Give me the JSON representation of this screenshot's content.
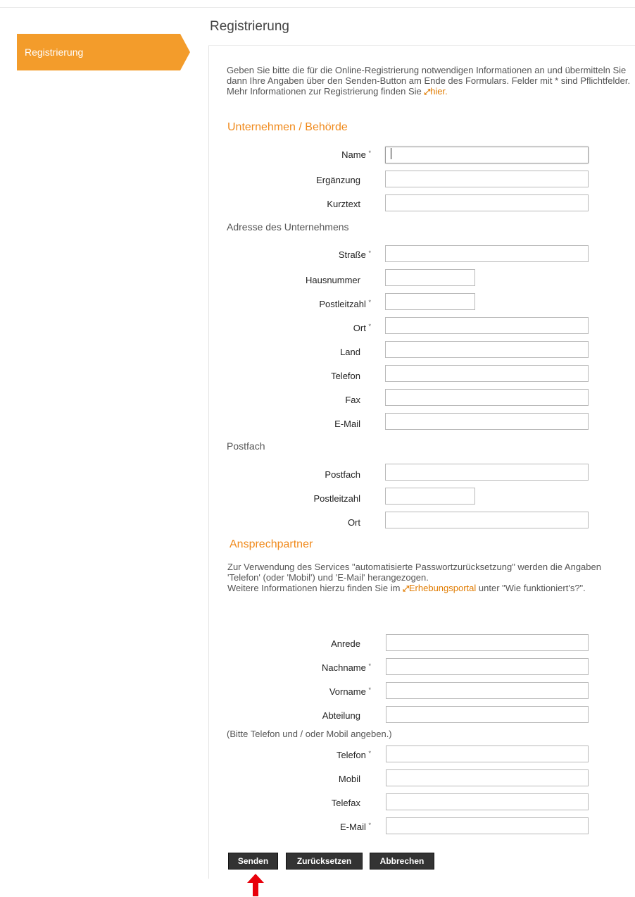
{
  "nav": {
    "item": "Registrierung"
  },
  "page_title": "Registrierung",
  "intro": {
    "text_before": "Geben Sie bitte die für die Online-Registrierung notwendigen Informationen an und übermitteln Sie dann Ihre Angaben über den Senden-Button am Ende des Formulars. Felder mit * sind Pflichtfelder. Mehr Informationen zur Registrierung finden Sie ",
    "link": "hier."
  },
  "company": {
    "title": "Unternehmen / Behörde",
    "name_label": "Name",
    "erg_label": "Ergänzung",
    "kurz_label": "Kurztext"
  },
  "address": {
    "title": "Adresse des Unternehmens",
    "strasse_label": "Straße",
    "hausnr_label": "Hausnummer",
    "plz_label": "Postleitzahl",
    "ort_label": "Ort",
    "land_label": "Land",
    "tel_label": "Telefon",
    "fax_label": "Fax",
    "email_label": "E-Mail"
  },
  "postfach": {
    "title": "Postfach",
    "postfach_label": "Postfach",
    "plz_label": "Postleitzahl",
    "ort_label": "Ort"
  },
  "contact": {
    "title": "Ansprechpartner",
    "info_1": "Zur Verwendung des Services \"automatisierte Passwortzurücksetzung\" werden die Angaben 'Telefon' (oder 'Mobil') und 'E-Mail' herangezogen.",
    "info_2_before": "Weitere Informationen hierzu finden Sie im ",
    "info_2_link": "Erhebungsportal",
    "info_2_after": " unter \"Wie funktioniert's?\".",
    "anrede_label": "Anrede",
    "nachname_label": "Nachname",
    "vorname_label": "Vorname",
    "abteilung_label": "Abteilung",
    "note": "(Bitte Telefon und / oder Mobil angeben.)",
    "tel_label": "Telefon",
    "mobil_label": "Mobil",
    "telefax_label": "Telefax",
    "email_label": "E-Mail"
  },
  "required_marker": "*",
  "buttons": {
    "send": "Senden",
    "reset": "Zurücksetzen",
    "cancel": "Abbrechen"
  },
  "colors": {
    "accent": "#f39c2b",
    "heading": "#f08a1c",
    "arrow": "#e8000b"
  }
}
